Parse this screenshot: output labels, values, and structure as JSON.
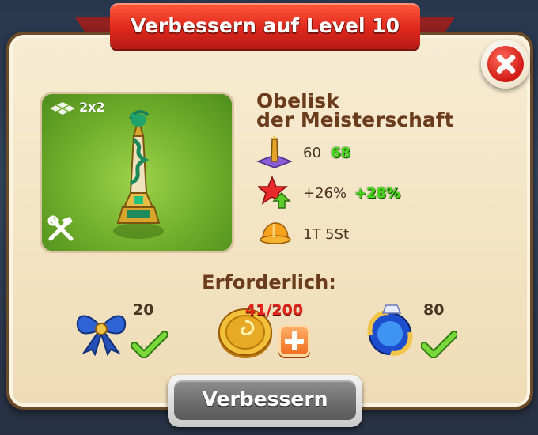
{
  "dialog": {
    "title": "Verbessern auf Level 10",
    "close_icon": "close-icon"
  },
  "building": {
    "name_line1": "Obelisk",
    "name_line2": "der Meisterschaft",
    "size": "2x2"
  },
  "stats": [
    {
      "icon": "obelisk-size-icon",
      "old": "60",
      "new": "68"
    },
    {
      "icon": "red-star-arrow-icon",
      "old": "+26%",
      "new": "+28%"
    },
    {
      "icon": "hard-hat-icon",
      "old": "1T 5St",
      "new": ""
    }
  ],
  "requirements": {
    "title": "Erforderlich:",
    "items": [
      {
        "icon": "blue-bow-icon",
        "count": "20",
        "fulfilled": true
      },
      {
        "icon": "gold-coin-icon",
        "count": "41/200",
        "fulfilled": false
      },
      {
        "icon": "blue-orb-icon",
        "count": "80",
        "fulfilled": true
      }
    ]
  },
  "action": {
    "upgrade_label": "Verbessern"
  },
  "colors": {
    "ribbon": "#e0281d",
    "panel": "#f2e2c2",
    "name_text": "#6a3c1c",
    "new_value_green": "#44d81a",
    "missing_red": "#e2261c"
  }
}
